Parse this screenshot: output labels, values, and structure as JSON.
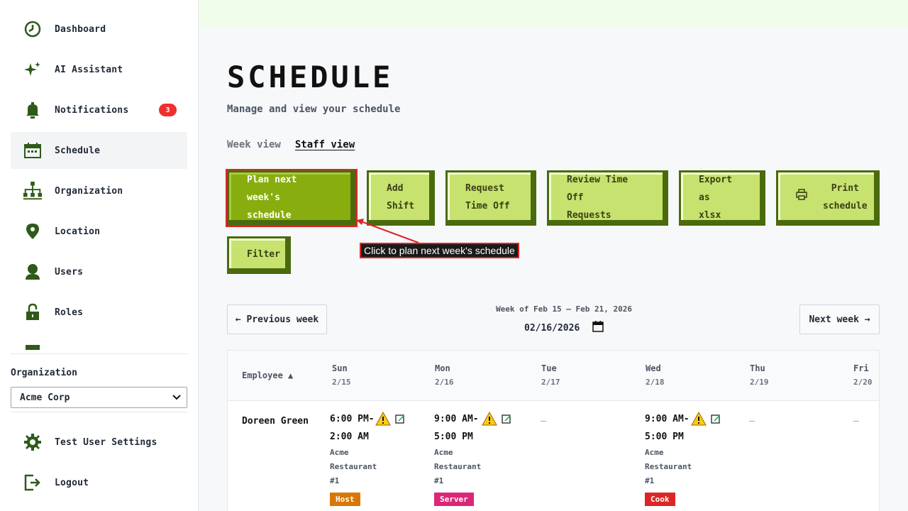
{
  "sidebar": {
    "items": [
      {
        "label": "Dashboard",
        "icon": "clock-icon"
      },
      {
        "label": "AI Assistant",
        "icon": "sparkle-icon"
      },
      {
        "label": "Notifications",
        "icon": "bell-icon",
        "badge": "3"
      },
      {
        "label": "Schedule",
        "icon": "calendar-icon",
        "active": true
      },
      {
        "label": "Organization",
        "icon": "org-chart-icon"
      },
      {
        "label": "Location",
        "icon": "location-pin-icon"
      },
      {
        "label": "Users",
        "icon": "user-icon"
      },
      {
        "label": "Roles",
        "icon": "lock-icon"
      }
    ],
    "org_label": "Organization",
    "org_selected": "Acme Corp",
    "settings_label": "Test User Settings",
    "logout_label": "Logout"
  },
  "page": {
    "title": "SCHEDULE",
    "subtitle": "Manage and view your schedule",
    "views": [
      "Week view",
      "Staff view"
    ],
    "active_view": "Staff view"
  },
  "actions": {
    "plan": [
      "Plan next week's",
      "schedule"
    ],
    "add": [
      "Add",
      "Shift"
    ],
    "request": [
      "Request",
      "Time Off"
    ],
    "review": [
      "Review Time Off",
      "Requests"
    ],
    "export": [
      "Export as",
      "xlsx"
    ],
    "print": [
      "Print",
      "schedule"
    ],
    "filter": "Filter"
  },
  "tooltip": "Click to plan next week's schedule",
  "week": {
    "prev": "← Previous week",
    "next": "Next week →",
    "range": "Week of Feb 15 – Feb 21, 2026",
    "date_value": "02/16/2026"
  },
  "table": {
    "employee_header": "Employee ▲",
    "days": [
      {
        "name": "Sun",
        "date": "2/15"
      },
      {
        "name": "Mon",
        "date": "2/16"
      },
      {
        "name": "Tue",
        "date": "2/17"
      },
      {
        "name": "Wed",
        "date": "2/18"
      },
      {
        "name": "Thu",
        "date": "2/19"
      },
      {
        "name": "Fri",
        "date": "2/20"
      }
    ],
    "rows": [
      {
        "employee": "Doreen Green",
        "shifts": {
          "sun": {
            "time1": "6:00 PM-",
            "time2": "2:00 AM",
            "loc1": "Acme",
            "loc2": "Restaurant",
            "loc3": "#1",
            "role": "Host",
            "role_color": "#d97706"
          },
          "mon": {
            "time1": "9:00 AM-",
            "time2": "5:00 PM",
            "loc1": "Acme",
            "loc2": "Restaurant",
            "loc3": "#1",
            "role": "Server",
            "role_color": "#db2777"
          },
          "tue": "–",
          "wed": {
            "time1": "9:00 AM-",
            "time2": "5:00 PM",
            "loc1": "Acme",
            "loc2": "Restaurant",
            "loc3": "#1",
            "role": "Cook",
            "role_color": "#dc2626"
          },
          "thu": "–",
          "fri": "–"
        }
      }
    ]
  },
  "colors": {
    "accent": "#4a6a0e",
    "button_face": "#c7e26e",
    "primary_face": "#88ad0e",
    "badge": "#ef2f2f"
  }
}
